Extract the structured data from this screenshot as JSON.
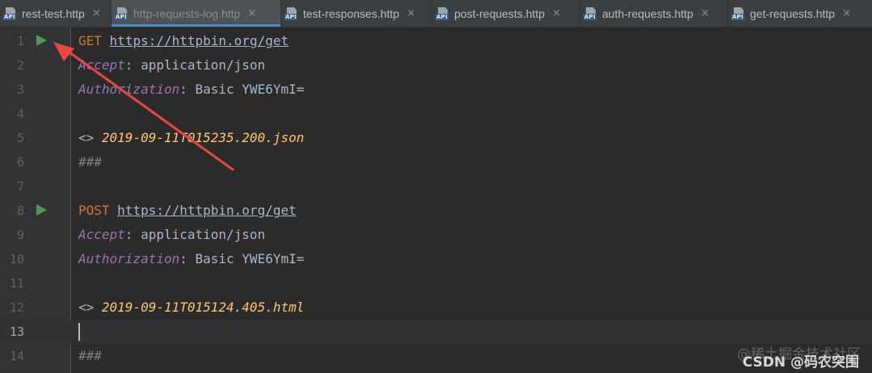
{
  "tabs": [
    {
      "label": "rest-test.http",
      "badge": "API",
      "active": false,
      "dim": false
    },
    {
      "label": "http-requests-log.http",
      "badge": "API",
      "active": true,
      "dim": true
    },
    {
      "label": "test-responses.http",
      "badge": "API",
      "active": false,
      "dim": false
    },
    {
      "label": "post-requests.http",
      "badge": "API",
      "active": false,
      "dim": false
    },
    {
      "label": "auth-requests.http",
      "badge": "API",
      "active": false,
      "dim": false
    },
    {
      "label": "get-requests.http",
      "badge": "API",
      "active": false,
      "dim": false
    }
  ],
  "tab_close_glyph": "×",
  "editor": {
    "line_numbers": [
      "1",
      "2",
      "3",
      "4",
      "5",
      "6",
      "7",
      "8",
      "9",
      "10",
      "11",
      "12",
      "13",
      "14"
    ],
    "current_line": 13,
    "request1": {
      "method": "GET",
      "url": "https://httpbin.org/get",
      "header1_name": "Accept",
      "header1_value": "application/json",
      "header2_name": "Authorization",
      "header2_value": "Basic YWE6YmI=",
      "response_marker": "<>",
      "response_file": "2019-09-11T015235.200.json",
      "separator": "###"
    },
    "request2": {
      "method": "POST",
      "url": "https://httpbin.org/get",
      "header1_name": "Accept",
      "header1_value": "application/json",
      "header2_name": "Authorization",
      "header2_value": "Basic YWE6YmI=",
      "response_marker": "<>",
      "response_file": "2019-09-11T015124.405.html",
      "separator": "###"
    },
    "header_separator": ": "
  },
  "watermark": {
    "line1": "@稀土掘金技术社区",
    "line2": "CSDN @码农突围"
  },
  "colors": {
    "background": "#2b2b2b",
    "gutter": "#313335",
    "method": "#cc7832",
    "header_name": "#9876aa",
    "response_file": "#ffc66d",
    "run_icon": "#499c54",
    "annotation_arrow": "#e8473f"
  }
}
